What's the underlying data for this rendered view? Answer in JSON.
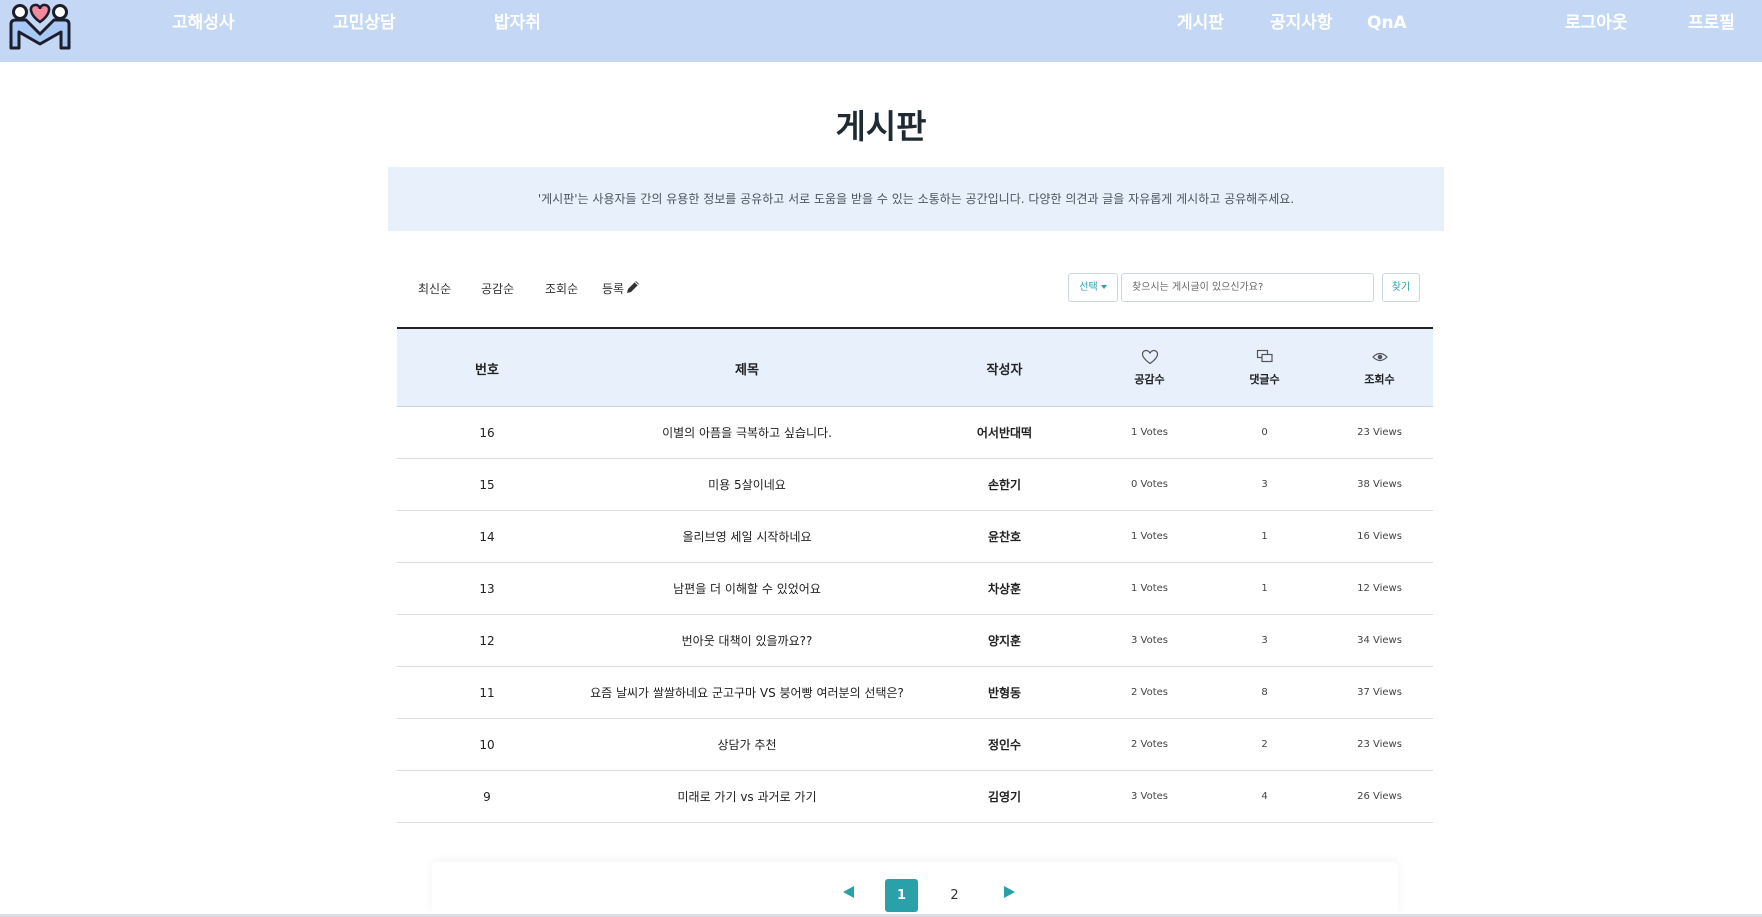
{
  "header": {
    "left_nav": [
      "고해성사",
      "고민상담",
      "밥자취"
    ],
    "right_nav": [
      "게시판",
      "공지사항",
      "QnA"
    ],
    "user_nav": [
      "로그아웃",
      "프로필"
    ]
  },
  "page": {
    "title": "게시판",
    "intro": "'게시판'는 사용자들 간의 유용한 정보를 공유하고 서로 도움을 받을 수 있는 소통하는 공간입니다. 다양한 의견과 글을 자유롭게 게시하고 공유해주세요."
  },
  "toolbar": {
    "sort_latest": "최신순",
    "sort_likes": "공감순",
    "sort_views": "조회순",
    "write": "등록",
    "select_label": "선택",
    "search_placeholder": "찾으시는 게시글이 있으신가요?",
    "find_label": "찾기"
  },
  "table": {
    "headers": {
      "no": "번호",
      "title": "제목",
      "author": "작성자",
      "likes": "공감수",
      "comments": "댓글수",
      "views": "조회수"
    },
    "rows": [
      {
        "no": "16",
        "title": "이별의 아픔을 극복하고 싶습니다.",
        "author": "어서반대떡",
        "votes": "1 Votes",
        "comments": "0",
        "views": "23 Views"
      },
      {
        "no": "15",
        "title": "미용 5살이네요",
        "author": "손한기",
        "votes": "0 Votes",
        "comments": "3",
        "views": "38 Views"
      },
      {
        "no": "14",
        "title": "올리브영 세일 시작하네요",
        "author": "윤찬호",
        "votes": "1 Votes",
        "comments": "1",
        "views": "16 Views"
      },
      {
        "no": "13",
        "title": "남편을 더 이해할 수 있었어요",
        "author": "차상훈",
        "votes": "1 Votes",
        "comments": "1",
        "views": "12 Views"
      },
      {
        "no": "12",
        "title": "번아웃 대책이 있을까요??",
        "author": "양지훈",
        "votes": "3 Votes",
        "comments": "3",
        "views": "34 Views"
      },
      {
        "no": "11",
        "title": "요즘 날씨가 쌀쌀하네요 군고구마 VS 붕어빵 여러분의 선택은?",
        "author": "반형동",
        "votes": "2 Votes",
        "comments": "8",
        "views": "37 Views"
      },
      {
        "no": "10",
        "title": "상담가 추천",
        "author": "정인수",
        "votes": "2 Votes",
        "comments": "2",
        "views": "23 Views"
      },
      {
        "no": "9",
        "title": "미래로 가기 vs 과거로 가기",
        "author": "김영기",
        "votes": "3 Votes",
        "comments": "4",
        "views": "26 Views"
      }
    ]
  },
  "pagination": {
    "pages": [
      "1",
      "2"
    ],
    "current": "1"
  },
  "colors": {
    "header_bg": "#c4d8f6",
    "accent": "#2aa0a8",
    "panel_bg": "#e8f0fc"
  }
}
